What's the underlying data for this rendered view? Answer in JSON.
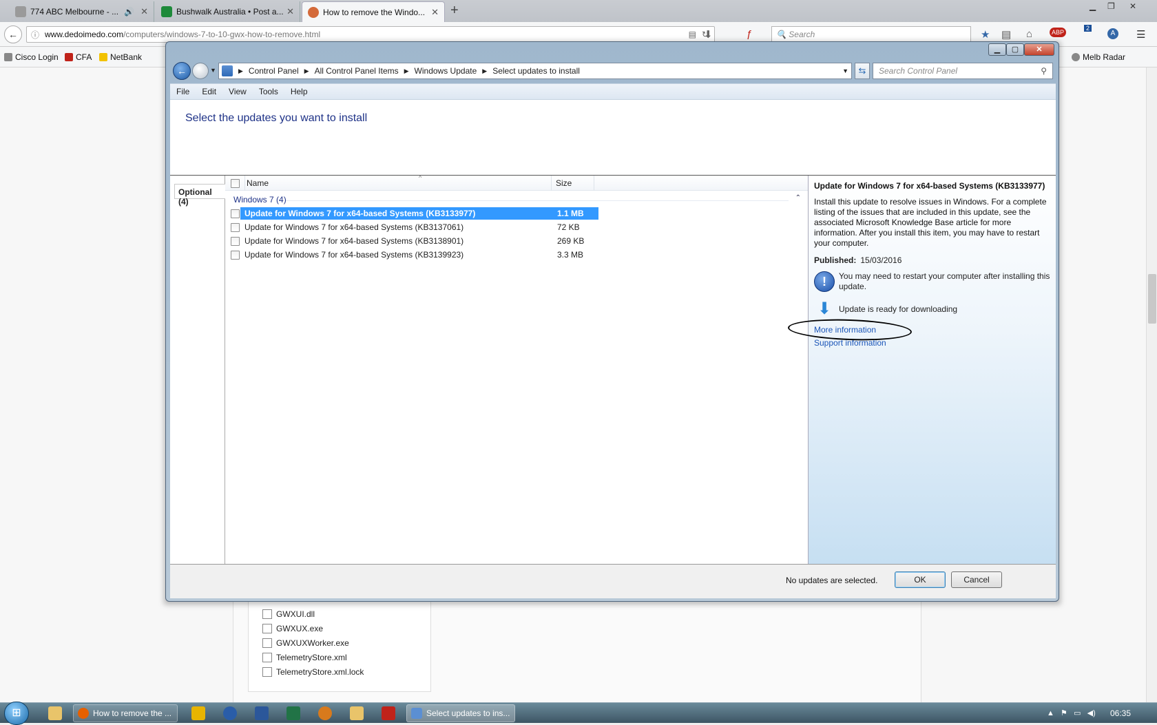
{
  "browser": {
    "tabs": [
      {
        "label": "774 ABC Melbourne - ...",
        "color": "#9a9a9a"
      },
      {
        "label": "Bushwalk Australia • Post a...",
        "color": "#1e8a3a"
      },
      {
        "label": "How to remove the Windo...",
        "color": "#d46a3a"
      }
    ],
    "url_domain": "www.dedoimedo.com",
    "url_path": "/computers/windows-7-to-10-gwx-how-to-remove.html",
    "search_placeholder": "Search",
    "notification_count": "2",
    "abp_label": "ABP",
    "bookmarks": [
      "Cisco Login",
      "CFA",
      "NetBank",
      "Melb Radar"
    ],
    "bookmarks_partial": "a"
  },
  "background_files": [
    "GWXUI.dll",
    "GWXUX.exe",
    "GWXUXWorker.exe",
    "TelemetryStore.xml",
    "TelemetryStore.xml.lock"
  ],
  "dialog": {
    "breadcrumb": [
      "Control Panel",
      "All Control Panel Items",
      "Windows Update",
      "Select updates to install"
    ],
    "search_placeholder": "Search Control Panel",
    "menu": [
      "File",
      "Edit",
      "View",
      "Tools",
      "Help"
    ],
    "page_title": "Select the updates you want to install",
    "optional_tab": "Optional (4)",
    "columns": {
      "name": "Name",
      "size": "Size"
    },
    "group_label": "Windows 7 (4)",
    "updates": [
      {
        "name": "Update for Windows 7 for x64-based Systems (KB3133977)",
        "size": "1.1 MB",
        "selected": true
      },
      {
        "name": "Update for Windows 7 for x64-based Systems (KB3137061)",
        "size": "72 KB",
        "selected": false
      },
      {
        "name": "Update for Windows 7 for x64-based Systems (KB3138901)",
        "size": "269 KB",
        "selected": false
      },
      {
        "name": "Update for Windows 7 for x64-based Systems (KB3139923)",
        "size": "3.3 MB",
        "selected": false
      }
    ],
    "details": {
      "title": "Update for Windows 7 for x64-based Systems (KB3133977)",
      "description": "Install this update to resolve issues in Windows. For a complete listing of the issues that are included in this update, see the associated Microsoft Knowledge Base article for more information. After you install this item, you may have to restart your computer.",
      "published_label": "Published:",
      "published_value": "15/03/2016",
      "restart_note": "You may need to restart your computer after installing this update.",
      "ready_note": "Update is ready for downloading",
      "more_info_link": "More information",
      "support_link": "Support information"
    },
    "status": "No updates are selected.",
    "ok_label": "OK",
    "cancel_label": "Cancel"
  },
  "taskbar": {
    "firefox_item": "How to remove the ...",
    "cp_item": "Select updates to ins...",
    "clock": "06:35"
  },
  "colors": {
    "selection": "#3399ff",
    "link": "#1a55b8",
    "title_blue": "#1e3287"
  }
}
